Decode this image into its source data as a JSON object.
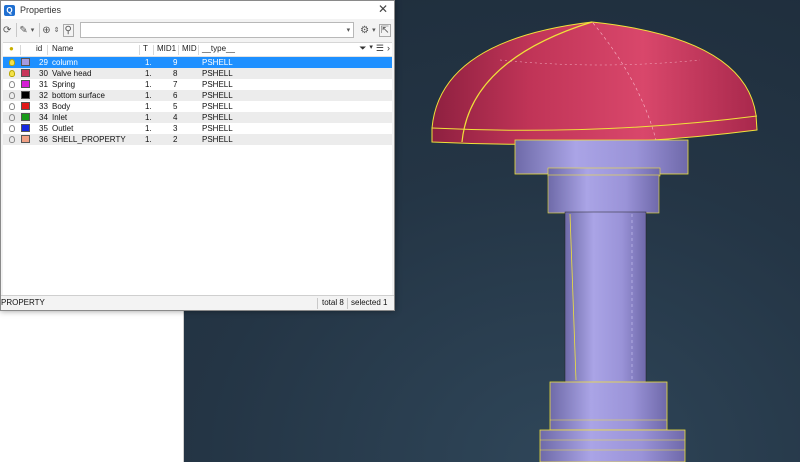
{
  "window": {
    "title": "Properties",
    "close_glyph": "✕",
    "app_icon_glyph": "Q"
  },
  "toolbar": {
    "icons": [
      "refresh-icon",
      "probe-icon",
      "chevron-down-icon",
      "zoom-icon",
      "stepper-icon",
      "search-icon",
      "settings-icon",
      "cursor-icon"
    ],
    "search_value": "",
    "search_placeholder": ""
  },
  "table": {
    "headers": {
      "visible": "",
      "color": "",
      "id": "id",
      "name": "Name",
      "t": "T",
      "mid1": "MID1",
      "mid": "MID",
      "type": "__type__"
    },
    "rows": [
      {
        "id": "29",
        "name": "column",
        "t": "1.",
        "mid1": "9",
        "mid": "",
        "type": "PSHELL",
        "color": "#a59be0",
        "visible": true,
        "selected": true
      },
      {
        "id": "30",
        "name": "Valve head",
        "t": "1.",
        "mid1": "8",
        "mid": "",
        "type": "PSHELL",
        "color": "#c8365a",
        "visible": true,
        "selected": false
      },
      {
        "id": "31",
        "name": "Spring",
        "t": "1.",
        "mid1": "7",
        "mid": "",
        "type": "PSHELL",
        "color": "#d61fd6",
        "visible": false,
        "selected": false
      },
      {
        "id": "32",
        "name": "bottom surface",
        "t": "1.",
        "mid1": "6",
        "mid": "",
        "type": "PSHELL",
        "color": "#000000",
        "visible": false,
        "selected": false
      },
      {
        "id": "33",
        "name": "Body",
        "t": "1.",
        "mid1": "5",
        "mid": "",
        "type": "PSHELL",
        "color": "#e01818",
        "visible": false,
        "selected": false
      },
      {
        "id": "34",
        "name": "Inlet",
        "t": "1.",
        "mid1": "4",
        "mid": "",
        "type": "PSHELL",
        "color": "#1a9a1a",
        "visible": false,
        "selected": false
      },
      {
        "id": "35",
        "name": "Outlet",
        "t": "1.",
        "mid1": "3",
        "mid": "",
        "type": "PSHELL",
        "color": "#1428e0",
        "visible": false,
        "selected": false
      },
      {
        "id": "36",
        "name": "SHELL_PROPERTY",
        "t": "1.",
        "mid1": "2",
        "mid": "",
        "type": "PSHELL",
        "color": "#f0a084",
        "visible": false,
        "selected": false
      }
    ]
  },
  "status": {
    "left": "PROPERTY",
    "total": "total 8",
    "selected": "selected 1"
  },
  "model": {
    "head_color": "#c8365a",
    "column_color": "#a59be0",
    "edge_color": "#f0e23a"
  }
}
